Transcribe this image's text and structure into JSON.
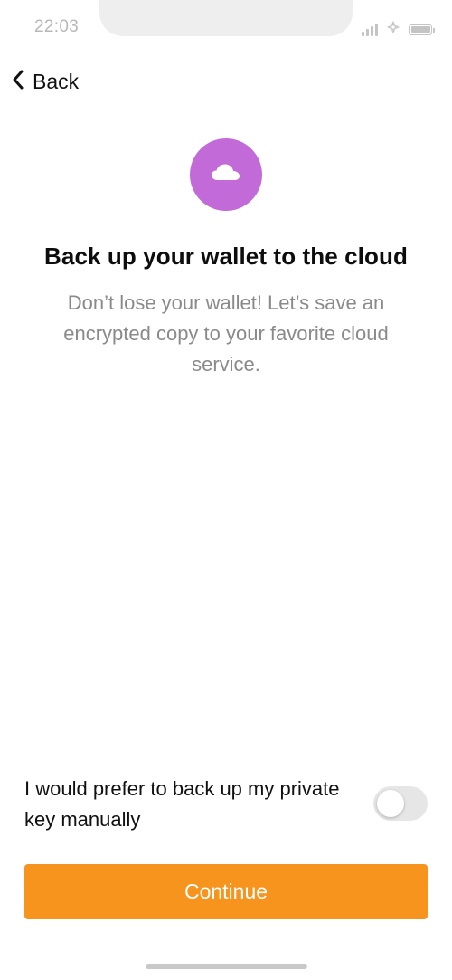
{
  "status_bar": {
    "time": "22:03",
    "icons": [
      "signal-icon",
      "wifi-icon",
      "battery-icon"
    ]
  },
  "nav": {
    "back_label": "Back",
    "back_icon": "chevron-left-icon"
  },
  "hero": {
    "icon": "cloud-icon",
    "badge_color": "#c26ad8",
    "title": "Back up your wallet to the cloud",
    "subtitle": "Don’t lose your wallet! Let’s save an encrypted copy to your favorite cloud service."
  },
  "manual_backup": {
    "label": "I would prefer to back up my private key manually",
    "toggle_on": false
  },
  "footer": {
    "continue_label": "Continue",
    "accent_color": "#f7941d"
  }
}
